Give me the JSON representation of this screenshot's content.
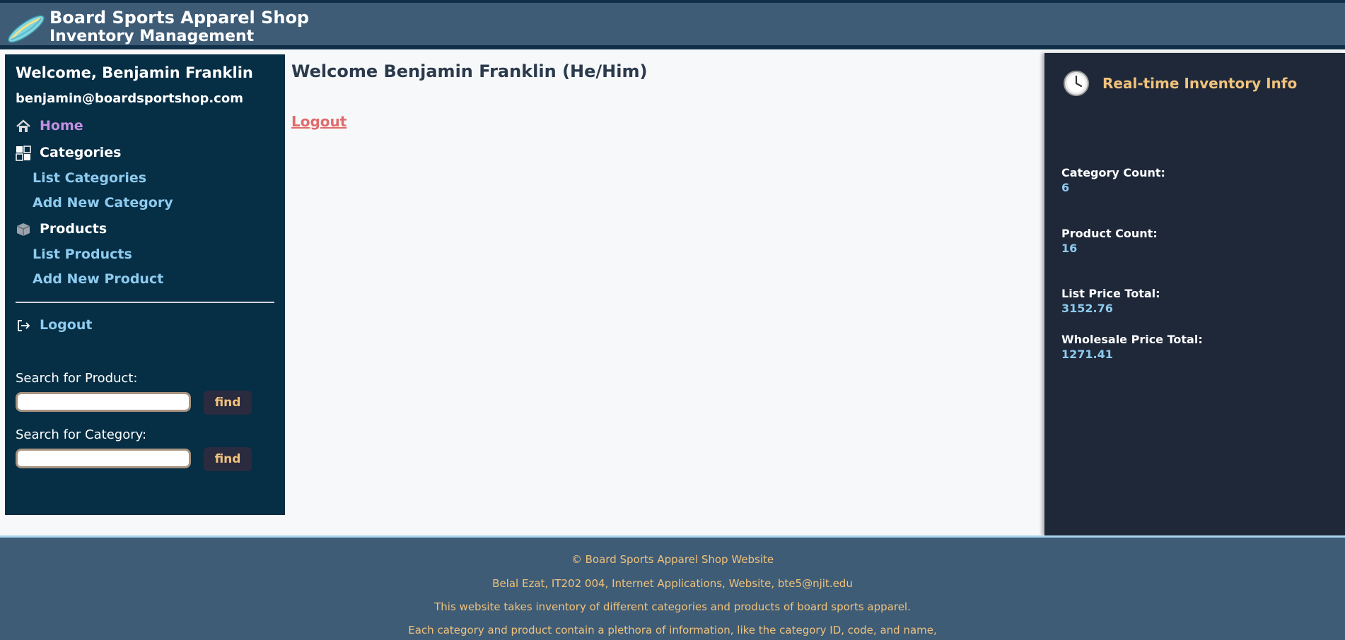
{
  "header": {
    "title_line1": "Board Sports Apparel Shop",
    "title_line2": "Inventory Management",
    "logo_icon": "surfboard-icon"
  },
  "sidebar": {
    "welcome": "Welcome, Benjamin Franklin",
    "email": "benjamin@boardsportshop.com",
    "home_label": "Home",
    "categories_label": "Categories",
    "list_categories": "List Categories",
    "add_category": "Add New Category",
    "products_label": "Products",
    "list_products": "List Products",
    "add_product": "Add New Product",
    "logout_label": "Logout",
    "search_product_label": "Search for Product:",
    "search_category_label": "Search for Category:",
    "find_label": "find"
  },
  "main": {
    "title": "Welcome Benjamin Franklin (He/Him)",
    "logout_link": "Logout"
  },
  "right_panel": {
    "title": "Real-time Inventory Info",
    "category_count_label": "Category Count:",
    "category_count": "6",
    "product_count_label": "Product Count:",
    "product_count": "16",
    "list_price_label": "List Price Total:",
    "list_price": "3152.76",
    "wholesale_label": "Wholesale Price Total:",
    "wholesale": "1271.41"
  },
  "footer": {
    "line1": "© Board Sports Apparel Shop Website",
    "line2": "Belal Ezat, IT202 004, Internet Applications, Website, bte5@njit.edu",
    "line3": "This website takes inventory of different categories and products of board sports apparel.",
    "line4": "Each category and product contain a plethora of information, like the category ID, code, and name,"
  },
  "colors": {
    "header_bg": "#3e5c76",
    "sidebar_bg": "#062e45",
    "right_panel_bg": "#1e2839",
    "accent_gold": "#f1c27b",
    "link_blue": "#8ecbee",
    "home_purple": "#c58fe0",
    "logout_red": "#e06b6b"
  }
}
